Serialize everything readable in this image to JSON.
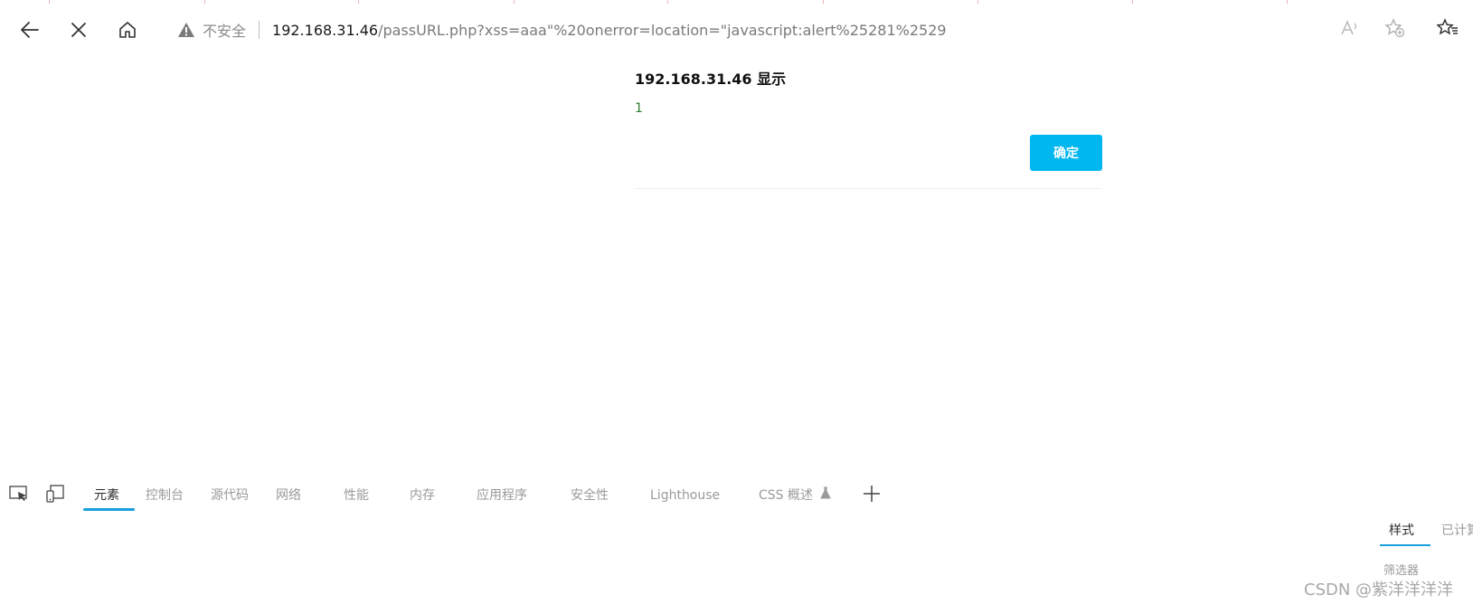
{
  "browser": {
    "address_bar": {
      "security_label": "不安全",
      "url_host": "192.168.31.46",
      "url_rest": "/passURL.php?xss=aaa\"%20onerror=location=\"javascript:alert%25281%2529"
    },
    "icons": {
      "back": "back-arrow-icon",
      "stop": "close-icon",
      "home": "home-icon",
      "warning": "warning-icon",
      "read_aloud": "read-aloud-icon",
      "add_favorite": "add-favorite-icon",
      "favorites": "favorites-icon"
    }
  },
  "dialog": {
    "title": "192.168.31.46 显示",
    "message": "1",
    "ok_label": "确定",
    "ok_color": "#00b7f0"
  },
  "devtools": {
    "tabs": [
      {
        "label": "元素",
        "active": true
      },
      {
        "label": "控制台"
      },
      {
        "label": "源代码"
      },
      {
        "label": "网络"
      },
      {
        "label": "性能"
      },
      {
        "label": "内存"
      },
      {
        "label": "应用程序"
      },
      {
        "label": "安全性"
      },
      {
        "label": "Lighthouse"
      },
      {
        "label": "CSS 概述"
      }
    ],
    "experimental_icon": "flask-icon",
    "accent_color": "#1aa0e0",
    "side_pane": {
      "tabs": [
        {
          "label": "样式",
          "active": true
        },
        {
          "label": "已计算"
        }
      ],
      "filter_label": "筛选器"
    }
  },
  "watermark": "CSDN @紫洋洋洋洋"
}
